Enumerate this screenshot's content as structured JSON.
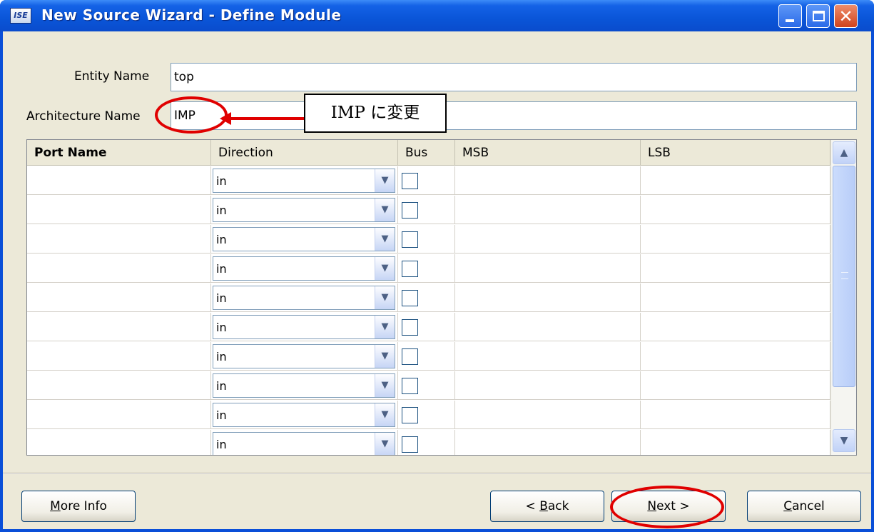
{
  "window": {
    "title": "New Source Wizard - Define Module",
    "app_icon_text": "ISE"
  },
  "fields": {
    "entity_label": "Entity Name",
    "entity_value": "top",
    "arch_label": "Architecture Name",
    "arch_value": "IMP"
  },
  "annotation": {
    "callout": "IMP に変更"
  },
  "table": {
    "headers": {
      "port_name": "Port Name",
      "direction": "Direction",
      "bus": "Bus",
      "msb": "MSB",
      "lsb": "LSB"
    },
    "rows": [
      {
        "port": "",
        "direction": "in",
        "bus": false,
        "msb": "",
        "lsb": ""
      },
      {
        "port": "",
        "direction": "in",
        "bus": false,
        "msb": "",
        "lsb": ""
      },
      {
        "port": "",
        "direction": "in",
        "bus": false,
        "msb": "",
        "lsb": ""
      },
      {
        "port": "",
        "direction": "in",
        "bus": false,
        "msb": "",
        "lsb": ""
      },
      {
        "port": "",
        "direction": "in",
        "bus": false,
        "msb": "",
        "lsb": ""
      },
      {
        "port": "",
        "direction": "in",
        "bus": false,
        "msb": "",
        "lsb": ""
      },
      {
        "port": "",
        "direction": "in",
        "bus": false,
        "msb": "",
        "lsb": ""
      },
      {
        "port": "",
        "direction": "in",
        "bus": false,
        "msb": "",
        "lsb": ""
      },
      {
        "port": "",
        "direction": "in",
        "bus": false,
        "msb": "",
        "lsb": ""
      },
      {
        "port": "",
        "direction": "in",
        "bus": false,
        "msb": "",
        "lsb": ""
      }
    ]
  },
  "buttons": {
    "more_info": {
      "mnemonic": "M",
      "rest": "ore Info"
    },
    "back": {
      "prefix": "< ",
      "mnemonic": "B",
      "rest": "ack"
    },
    "next": {
      "mnemonic": "N",
      "rest": "ext >"
    },
    "cancel": {
      "mnemonic": "C",
      "rest": "ancel"
    }
  },
  "icons": [
    "app-icon",
    "minimize-icon",
    "maximize-icon",
    "close-icon",
    "chevron-down-icon",
    "scroll-up-icon",
    "scroll-down-icon"
  ]
}
